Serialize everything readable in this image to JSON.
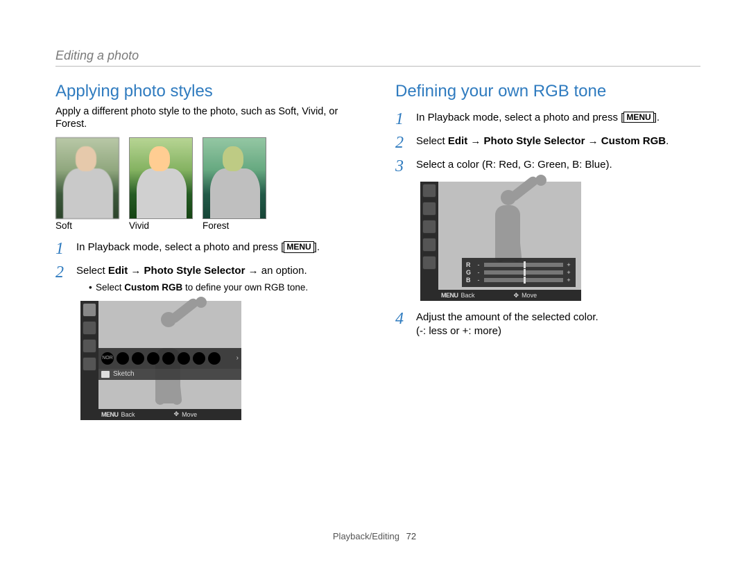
{
  "breadcrumb": "Editing a photo",
  "left": {
    "heading": "Applying photo styles",
    "intro": "Apply a different photo style to the photo, such as Soft, Vivid, or Forest.",
    "thumbs": [
      {
        "caption": "Soft"
      },
      {
        "caption": "Vivid"
      },
      {
        "caption": "Forest"
      }
    ],
    "steps": {
      "s1_prefix": "In Playback mode, select a photo and press [",
      "s1_menu": "MENU",
      "s1_suffix": "].",
      "s2_pre": "Select ",
      "s2_b1": "Edit",
      "s2_arrow1": " → ",
      "s2_b2": "Photo Style Selector",
      "s2_arrow2": " → ",
      "s2_post": "an option.",
      "s2_sub_pre": "Select ",
      "s2_sub_bold": "Custom RGB",
      "s2_sub_post": " to define your own RGB tone."
    },
    "cam": {
      "strip_label": "Sketch",
      "footer_menu": "MENU",
      "footer_back": "Back",
      "footer_move": "Move"
    }
  },
  "right": {
    "heading": "Defining your own RGB tone",
    "steps": {
      "s1_prefix": "In Playback mode, select a photo and press [",
      "s1_menu": "MENU",
      "s1_suffix": "].",
      "s2_pre": "Select ",
      "s2_b1": "Edit",
      "s2_arrow1": " → ",
      "s2_b2": "Photo Style Selector",
      "s2_arrow2": " → ",
      "s2_b3": "Custom RGB",
      "s2_post": ".",
      "s3": "Select a color (R: Red, G: Green, B: Blue).",
      "s4a": "Adjust the amount of the selected color.",
      "s4b": "(-: less or +: more)"
    },
    "cam": {
      "rgb": {
        "r": "R",
        "g": "G",
        "b": "B"
      },
      "footer_menu": "MENU",
      "footer_back": "Back",
      "footer_move": "Move"
    }
  },
  "footer": {
    "section": "Playback/Editing",
    "page": "72"
  }
}
